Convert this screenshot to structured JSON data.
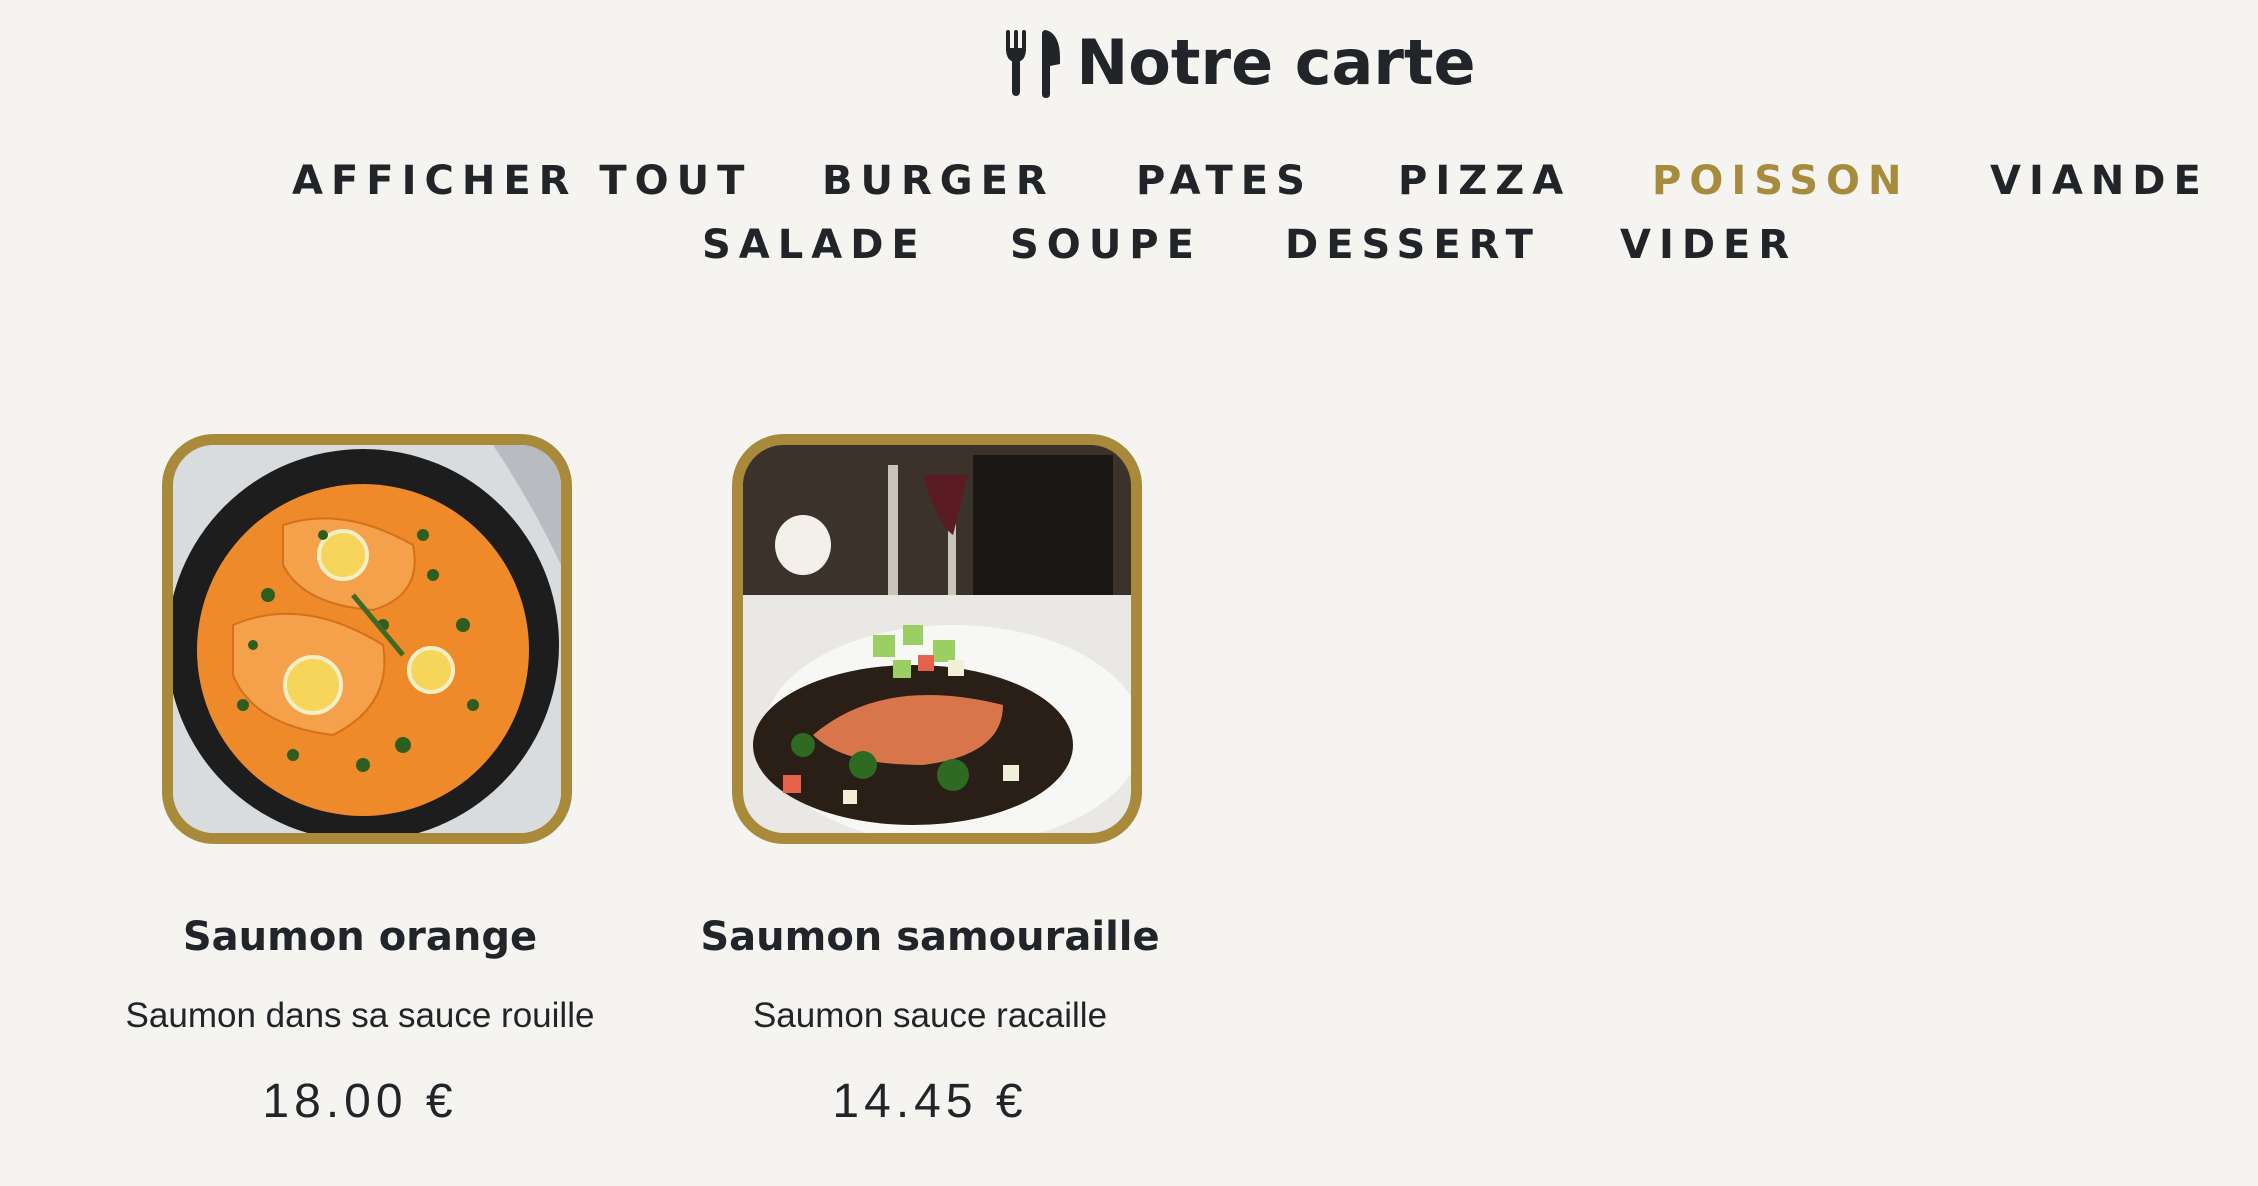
{
  "header": {
    "title": "Notre carte",
    "icon": "utensils-icon"
  },
  "filters": [
    {
      "label": "AFFICHER TOUT",
      "active": false
    },
    {
      "label": "BURGER",
      "active": false
    },
    {
      "label": "PATES",
      "active": false
    },
    {
      "label": "PIZZA",
      "active": false
    },
    {
      "label": "POISSON",
      "active": true
    },
    {
      "label": "VIANDE",
      "active": false
    },
    {
      "label": "SALADE",
      "active": false
    },
    {
      "label": "SOUPE",
      "active": false
    },
    {
      "label": "DESSERT",
      "active": false
    },
    {
      "label": "VIDER",
      "active": false
    }
  ],
  "items": [
    {
      "name": "Saumon orange",
      "description": "Saumon dans sa sauce rouille",
      "price": "18.00 €"
    },
    {
      "name": "Saumon samouraille",
      "description": "Saumon sauce racaille",
      "price": "14.45 €"
    }
  ],
  "colors": {
    "accent": "#a88c3d",
    "text": "#212529",
    "background": "#f5f4f0",
    "image_border": "#a88a3a"
  }
}
